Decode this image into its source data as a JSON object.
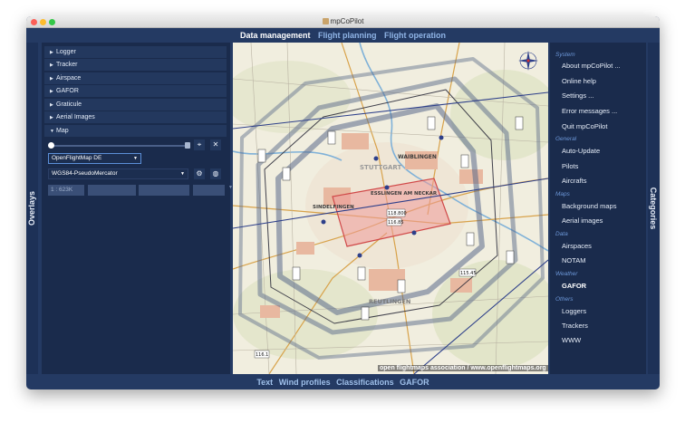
{
  "window": {
    "title": "mpCoPilot"
  },
  "top_nav": [
    {
      "label": "Data management",
      "active": true
    },
    {
      "label": "Flight planning",
      "active": false
    },
    {
      "label": "Flight operation",
      "active": false
    }
  ],
  "bottom_nav": [
    "Text",
    "Wind profiles",
    "Classifications",
    "GAFOR"
  ],
  "side_tabs": {
    "left": "Overlays",
    "right": "Categories"
  },
  "overlays": {
    "items": [
      {
        "label": "Logger",
        "expanded": false
      },
      {
        "label": "Tracker",
        "expanded": false
      },
      {
        "label": "Airspace",
        "expanded": false
      },
      {
        "label": "GAFOR",
        "expanded": false
      },
      {
        "label": "Graticule",
        "expanded": false
      },
      {
        "label": "Aerial Images",
        "expanded": false
      },
      {
        "label": "Map",
        "expanded": true
      }
    ],
    "map": {
      "opacity_fraction": 0.0,
      "map_source": "OpenFlightMap DE",
      "projection": "WGS84-PseudoMercator",
      "scale": "1 : 623K",
      "fields": [
        "",
        "",
        ""
      ]
    }
  },
  "map_view": {
    "attribution": "open flightmaps association / www.openflightmaps.org",
    "labels": {
      "waiblingen": "WAIBLINGEN",
      "esslingen": "ESSLINGEN AM NECKAR",
      "sindelfingen": "SINDELFINGEN",
      "reutlingen": "REUTLINGEN",
      "stuttgart": "STUTTGART"
    },
    "frequencies": [
      "118.800",
      "116.85",
      "115.45",
      "116.1"
    ]
  },
  "categories": {
    "groups": [
      {
        "title": "System",
        "items": [
          "About mpCoPilot ...",
          "Online help",
          "Settings ...",
          "Error messages ...",
          "Quit mpCoPilot"
        ]
      },
      {
        "title": "General",
        "items": [
          "Auto-Update",
          "Pilots",
          "Aircrafts"
        ]
      },
      {
        "title": "Maps",
        "items": [
          "Background maps",
          "Aerial images"
        ]
      },
      {
        "title": "Data",
        "items": [
          "Airspaces",
          "NOTAM"
        ]
      },
      {
        "title": "Weather",
        "items": [
          "GAFOR"
        ]
      },
      {
        "title": "Others",
        "items": [
          "Loggers",
          "Trackers",
          "WWW"
        ]
      }
    ],
    "active_item": "GAFOR"
  },
  "colors": {
    "window_bg": "#243a63",
    "panel_bg": "#1a2b4c",
    "row_bg": "#23385e",
    "accent": "#6c97d8",
    "airspace_blue": "#2d3f8a",
    "ctr_red": "#e06060"
  }
}
